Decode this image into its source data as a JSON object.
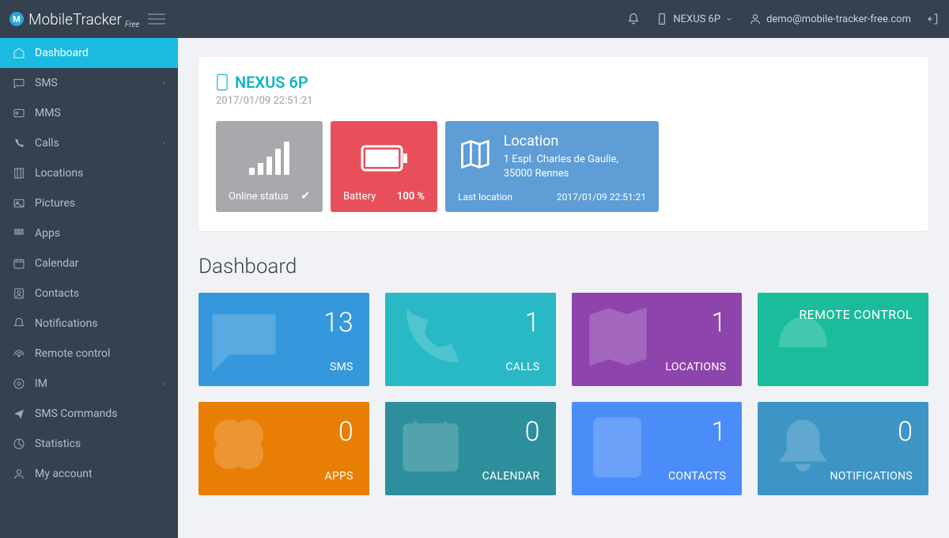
{
  "header": {
    "brand": "MobileTracker",
    "brand_sub": "Free",
    "device": "NEXUS 6P",
    "user_email": "demo@mobile-tracker-free.com"
  },
  "sidebar": {
    "items": [
      {
        "label": "Dashboard",
        "active": true,
        "expandable": false
      },
      {
        "label": "SMS",
        "active": false,
        "expandable": true
      },
      {
        "label": "MMS",
        "active": false,
        "expandable": false
      },
      {
        "label": "Calls",
        "active": false,
        "expandable": true
      },
      {
        "label": "Locations",
        "active": false,
        "expandable": false
      },
      {
        "label": "Pictures",
        "active": false,
        "expandable": false
      },
      {
        "label": "Apps",
        "active": false,
        "expandable": false
      },
      {
        "label": "Calendar",
        "active": false,
        "expandable": false
      },
      {
        "label": "Contacts",
        "active": false,
        "expandable": false
      },
      {
        "label": "Notifications",
        "active": false,
        "expandable": false
      },
      {
        "label": "Remote control",
        "active": false,
        "expandable": false
      },
      {
        "label": "IM",
        "active": false,
        "expandable": true
      },
      {
        "label": "SMS Commands",
        "active": false,
        "expandable": false
      },
      {
        "label": "Statistics",
        "active": false,
        "expandable": false
      },
      {
        "label": "My account",
        "active": false,
        "expandable": false
      }
    ]
  },
  "device_card": {
    "name": "NEXUS 6P",
    "timestamp": "2017/01/09 22:51:21",
    "online_label": "Online status",
    "battery_label": "Battery",
    "battery_value": "100 %",
    "location_title": "Location",
    "location_address": "1 Espl. Charles de Gaulle, 35000 Rennes",
    "last_location_label": "Last location",
    "last_location_time": "2017/01/09 22:51:21"
  },
  "dashboard": {
    "title": "Dashboard",
    "tiles": [
      {
        "count": "13",
        "label": "SMS",
        "color": "c-blue"
      },
      {
        "count": "1",
        "label": "CALLS",
        "color": "c-teal"
      },
      {
        "count": "1",
        "label": "LOCATIONS",
        "color": "c-purple"
      },
      {
        "count": "",
        "label": "REMOTE CONTROL",
        "color": "c-green",
        "remote": true
      },
      {
        "count": "0",
        "label": "APPS",
        "color": "c-orange"
      },
      {
        "count": "0",
        "label": "CALENDAR",
        "color": "c-dteal"
      },
      {
        "count": "1",
        "label": "CONTACTS",
        "color": "c-sblue"
      },
      {
        "count": "0",
        "label": "NOTIFICATIONS",
        "color": "c-mid"
      }
    ]
  }
}
